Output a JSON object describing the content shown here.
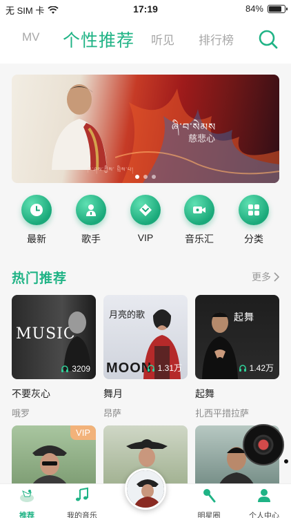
{
  "status": {
    "carrier": "无 SIM 卡",
    "time": "17:19",
    "battery": "84%",
    "battery_level": 0.84
  },
  "tabs": [
    {
      "label": "MV",
      "active": false
    },
    {
      "label": "个性推荐",
      "active": true
    },
    {
      "label": "听见",
      "active": false
    },
    {
      "label": "排行榜",
      "active": false
    }
  ],
  "banner": {
    "title_text": "ཞི་བ་སེམས",
    "subtitle": "慈悲心",
    "footer": "ཁ་ཤས་ཀྱིས་ བྲིས་པ།",
    "slides": 3,
    "active_slide": 0
  },
  "quick_actions": [
    {
      "label": "最新",
      "icon": "clock-icon"
    },
    {
      "label": "歌手",
      "icon": "singer-icon"
    },
    {
      "label": "VIP",
      "icon": "vip-icon"
    },
    {
      "label": "音乐汇",
      "icon": "video-icon"
    },
    {
      "label": "分类",
      "icon": "category-icon"
    }
  ],
  "section": {
    "title": "热门推荐",
    "more": "更多"
  },
  "cards": [
    {
      "title": "不要灰心",
      "artist": "哦罗",
      "plays": "3209",
      "cover_text": "MUSIC"
    },
    {
      "title": "舞月",
      "artist": "昂萨",
      "plays": "1.31万",
      "cover_text": "月亮的歌"
    },
    {
      "title": "起舞",
      "artist": "扎西平措拉萨",
      "plays": "1.42万",
      "cover_text": "起舞"
    }
  ],
  "row2": [
    {
      "badge": "VIP"
    },
    {
      "badge": ""
    },
    {
      "badge": ""
    }
  ],
  "nav": [
    {
      "label": "推荐",
      "active": true,
      "icon": "recommend-icon"
    },
    {
      "label": "我的音乐",
      "active": false,
      "icon": "music-note-icon"
    },
    {
      "label": "",
      "active": false,
      "icon": "now-playing-icon"
    },
    {
      "label": "明星圈",
      "active": false,
      "icon": "mic-icon"
    },
    {
      "label": "个人中心",
      "active": false,
      "icon": "user-icon"
    }
  ],
  "colors": {
    "accent": "#1fb385",
    "vip": "#f2b27a"
  }
}
